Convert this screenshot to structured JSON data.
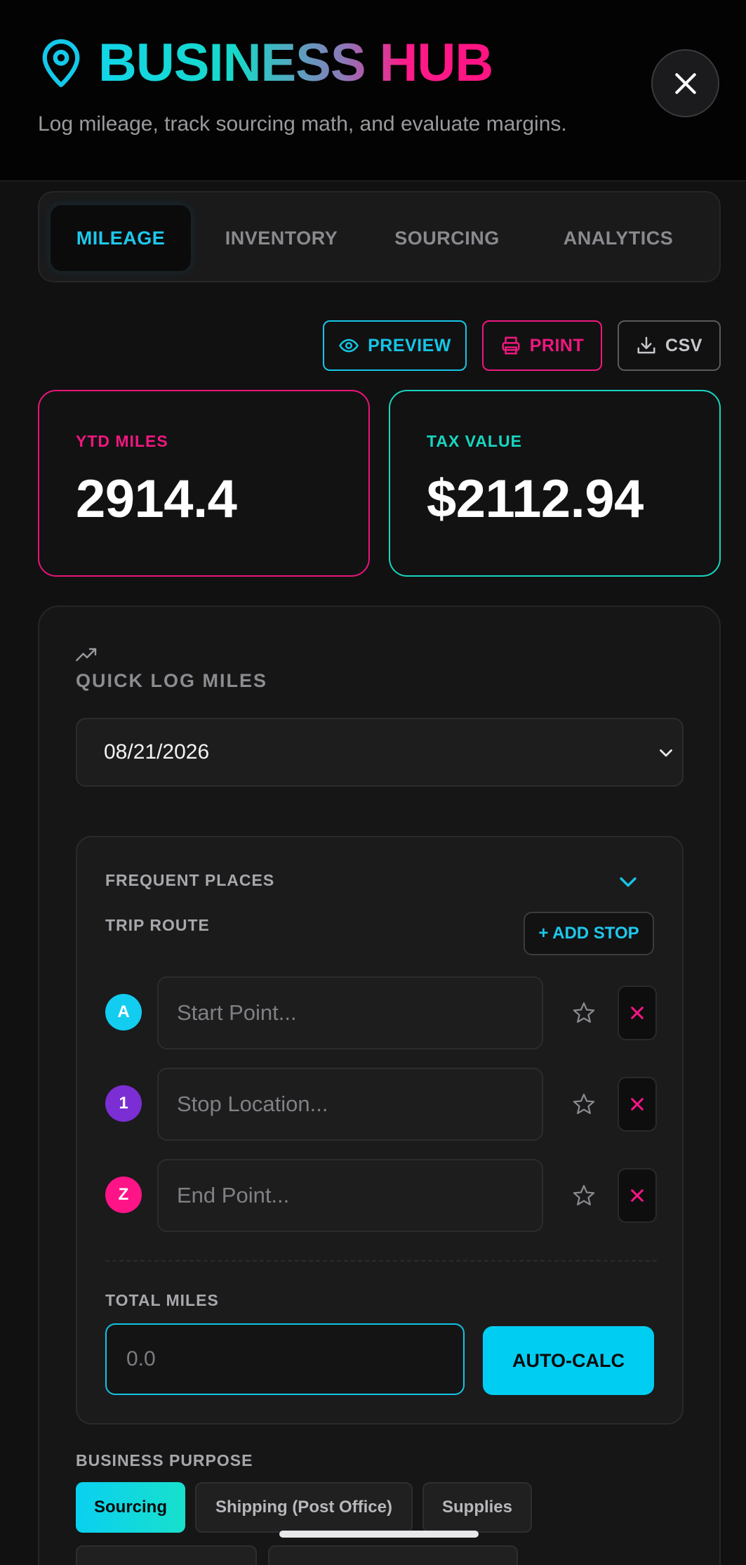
{
  "header": {
    "title": "BUSINESS HUB",
    "subtitle": "Log mileage, track sourcing math, and evaluate margins.",
    "icon": "map-pin-icon"
  },
  "tabs": [
    {
      "label": "MILEAGE",
      "active": true
    },
    {
      "label": "INVENTORY",
      "active": false
    },
    {
      "label": "SOURCING",
      "active": false
    },
    {
      "label": "ANALYTICS",
      "active": false
    }
  ],
  "actions": {
    "preview": "PREVIEW",
    "print": "PRINT",
    "csv": "CSV"
  },
  "stats": {
    "ytd_label": "YTD MILES",
    "ytd_value": "2914.4",
    "tax_label": "TAX VALUE",
    "tax_value": "$2112.94"
  },
  "quick_log": {
    "title": "QUICK LOG MILES",
    "date": "08/21/2026",
    "frequent_places_label": "FREQUENT PLACES",
    "trip_route_label": "TRIP ROUTE",
    "add_stop_label": "+ ADD STOP",
    "stops": [
      {
        "badge": "A",
        "placeholder": "Start Point...",
        "color": "#12cdf0"
      },
      {
        "badge": "1",
        "placeholder": "Stop Location...",
        "color": "#7b2ed4"
      },
      {
        "badge": "Z",
        "placeholder": "End Point...",
        "color": "#ff1488"
      }
    ],
    "total_miles_label": "TOTAL MILES",
    "total_miles_placeholder": "0.0",
    "autocalc_label": "AUTO-CALC",
    "purpose_label": "BUSINESS PURPOSE",
    "purposes": [
      {
        "label": "Sourcing",
        "active": true
      },
      {
        "label": "Shipping (Post Office)",
        "active": false
      },
      {
        "label": "Supplies",
        "active": false
      }
    ]
  },
  "colors": {
    "accent_cyan": "#15c6e6",
    "accent_pink": "#f0177f",
    "accent_teal": "#18d6bf",
    "background": "#111112"
  }
}
